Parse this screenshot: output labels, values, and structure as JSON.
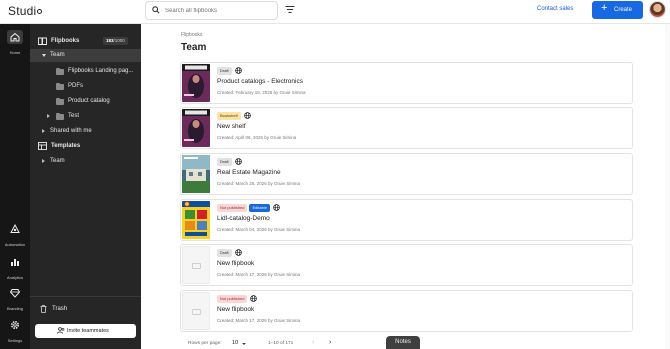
{
  "topbar": {
    "logo_text": "Studi",
    "search_placeholder": "Search all flipbooks",
    "contact_label": "Contact sales",
    "create_label": "Create"
  },
  "rail": [
    {
      "label": "Home",
      "icon": "home-icon"
    },
    {
      "label": "Automation",
      "icon": "automation-icon"
    },
    {
      "label": "Analytics",
      "icon": "analytics-icon"
    },
    {
      "label": "Branding",
      "icon": "branding-icon"
    },
    {
      "label": "Settings",
      "icon": "settings-icon"
    }
  ],
  "sidebar": {
    "flipbooks_label": "Flipbooks",
    "count_used": "183",
    "count_total": "/1000",
    "team_label": "Team",
    "folders": [
      "Flipbooks Landing pag...",
      "PDFs",
      "Product catalog",
      "Test"
    ],
    "shared_label": "Shared with me",
    "templates_label": "Templates",
    "templates_team_label": "Team",
    "trash_label": "Trash",
    "invite_label": "Invite teammates"
  },
  "main": {
    "breadcrumb": "Flipbooks",
    "title": "Team",
    "cards": [
      {
        "badges": [
          {
            "text": "Draft",
            "kind": "draft"
          }
        ],
        "title": "Product catalogs - Electronics",
        "meta": "Created: February 18, 2026 by Gruie Simina",
        "thumb": "magazine-purple"
      },
      {
        "badges": [
          {
            "text": "Bookshelf",
            "kind": "bookshelf"
          }
        ],
        "title": "New shelf",
        "meta": "Created: April 06, 2026 by Gruie Simina",
        "thumb": "magazine-purple"
      },
      {
        "badges": [
          {
            "text": "Draft",
            "kind": "draft"
          }
        ],
        "title": "Real Estate Magazine",
        "meta": "Created: March 25, 2026 by Gruie Simina",
        "thumb": "real-estate"
      },
      {
        "badges": [
          {
            "text": "Not published",
            "kind": "notpub"
          },
          {
            "text": "Editable",
            "kind": "editable"
          }
        ],
        "title": "Lidl-catalog-Demo",
        "meta": "Created: March 04, 2026 by Gruie Simina",
        "thumb": "lidl"
      },
      {
        "badges": [
          {
            "text": "Draft",
            "kind": "draft"
          }
        ],
        "title": "New flipbook",
        "meta": "Created: March 17, 2026 by Gruie Simina",
        "thumb": "placeholder"
      },
      {
        "badges": [
          {
            "text": "Not published",
            "kind": "notpub"
          }
        ],
        "title": "New flipbook",
        "meta": "Created: March 17, 2026 by Gruie Simina",
        "thumb": "placeholder"
      }
    ],
    "pager": {
      "rows_label": "Rows per page:",
      "rows_value": "10",
      "range": "1–10 of 171"
    }
  },
  "notes_label": "Notes",
  "colors": {
    "accent": "#1668e3",
    "rail_bg": "#161616",
    "sidebar_bg": "#262626"
  }
}
